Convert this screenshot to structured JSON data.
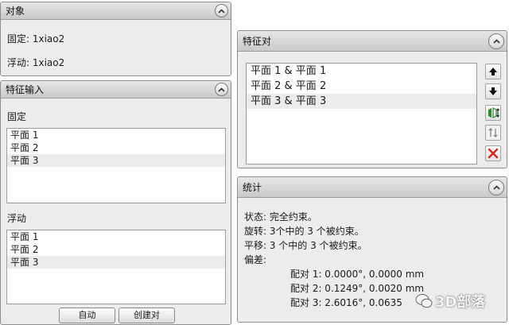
{
  "objects_panel": {
    "title": "对象",
    "fixed": "固定: 1xiao2",
    "floating": "浮动: 1xiao2"
  },
  "feature_input_panel": {
    "title": "特征输入",
    "fixed_label": "固定",
    "fixed_items": [
      "平面 1",
      "平面 2",
      "平面 3"
    ],
    "floating_label": "浮动",
    "floating_items": [
      "平面 1",
      "平面 2",
      "平面 3"
    ],
    "auto_button": "自动",
    "create_pair_button": "创建对"
  },
  "feature_pairs_panel": {
    "title": "特征对",
    "items": [
      "平面 1 & 平面 1",
      "平面 2 & 平面 2",
      "平面 3 & 平面 3"
    ],
    "buttons": [
      "arrow-up-icon",
      "arrow-down-icon",
      "flip-icon",
      "swap-icon",
      "delete-icon"
    ]
  },
  "statistics_panel": {
    "title": "统计",
    "status": "状态: 完全约束。",
    "rotation": "旋转: 3个中的 3 个被约束。",
    "translation": "平移: 3 个中的 3 个被约束。",
    "deviation_label": "偏差:",
    "pairs": [
      "配对 1:  0.0000°, 0.0000 mm",
      "配对 2:  0.1249°, 0.0020 mm",
      "配对 3:  2.6016°, 0.0635"
    ]
  },
  "watermark": "3D部落",
  "colors": {
    "panel_bg": "#ececec",
    "header_bg": "#d2d2d2",
    "delete_red": "#d9271c",
    "flip_green": "#2f8a2f"
  }
}
